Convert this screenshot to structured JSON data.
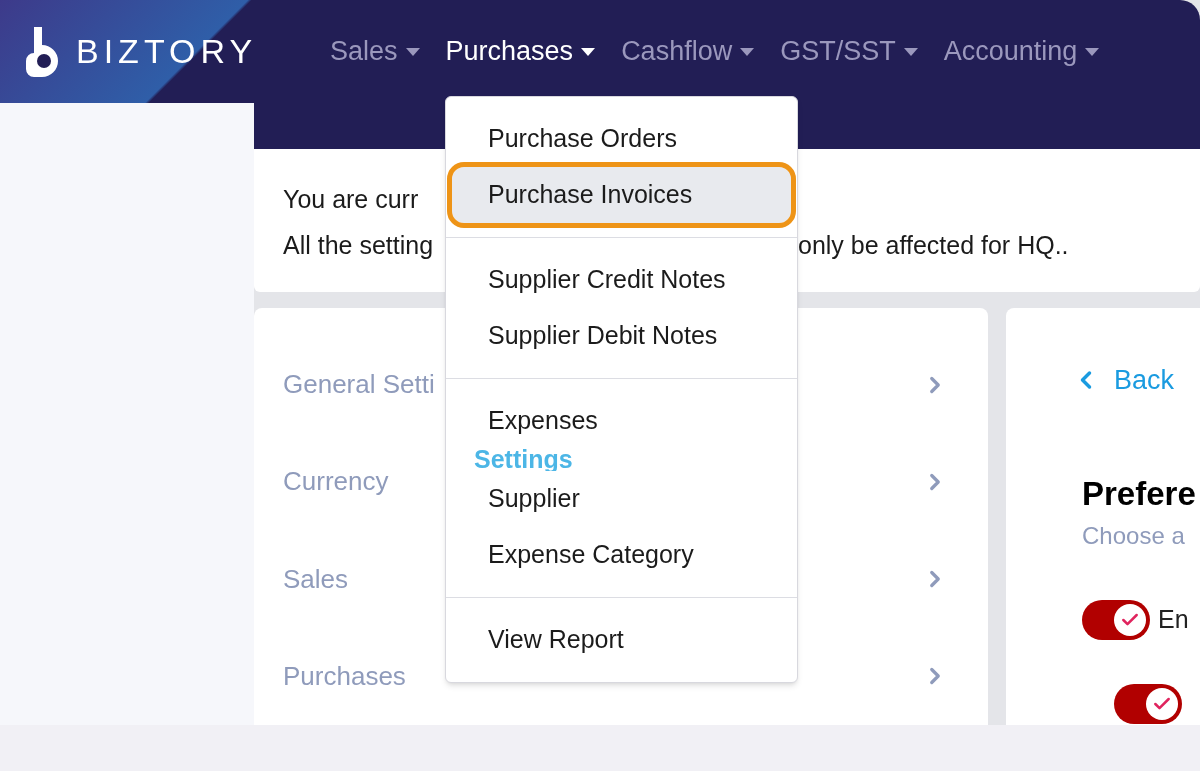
{
  "header": {
    "logo": "BIZTORY",
    "nav": [
      {
        "label": "Sales",
        "selected": false
      },
      {
        "label": "Purchases",
        "selected": true
      },
      {
        "label": "Cashflow",
        "selected": false
      },
      {
        "label": "GST/SST",
        "selected": false
      },
      {
        "label": "Accounting",
        "selected": false
      }
    ]
  },
  "notice": {
    "line_1": "You are curr",
    "line_2_start": "All the setting",
    "line_2_end": "only be affected for HQ.."
  },
  "settings_menu": [
    {
      "label": "General Setti"
    },
    {
      "label": "Currency"
    },
    {
      "label": "Sales"
    },
    {
      "label": "Purchases"
    }
  ],
  "detail": {
    "back": "Back",
    "title": "Prefere",
    "subtitle": "Choose a",
    "toggles": [
      {
        "label": "En",
        "on": true
      },
      {
        "on": true
      }
    ]
  },
  "dropdown": {
    "groups": [
      {
        "items": [
          {
            "label": "Purchase Orders",
            "selected": false
          },
          {
            "label": "Purchase Invoices",
            "selected": true
          }
        ]
      },
      {
        "items": [
          {
            "label": "Supplier Credit Notes",
            "selected": false
          },
          {
            "label": "Supplier Debit Notes",
            "selected": false
          }
        ]
      },
      {
        "items": [
          {
            "label": "Expenses",
            "selected": false
          }
        ],
        "heading": "Settings",
        "after_items": [
          {
            "label": "Supplier",
            "selected": false
          },
          {
            "label": "Expense Category",
            "selected": false
          }
        ]
      },
      {
        "items": [
          {
            "label": "View Report",
            "selected": false
          }
        ]
      }
    ]
  }
}
